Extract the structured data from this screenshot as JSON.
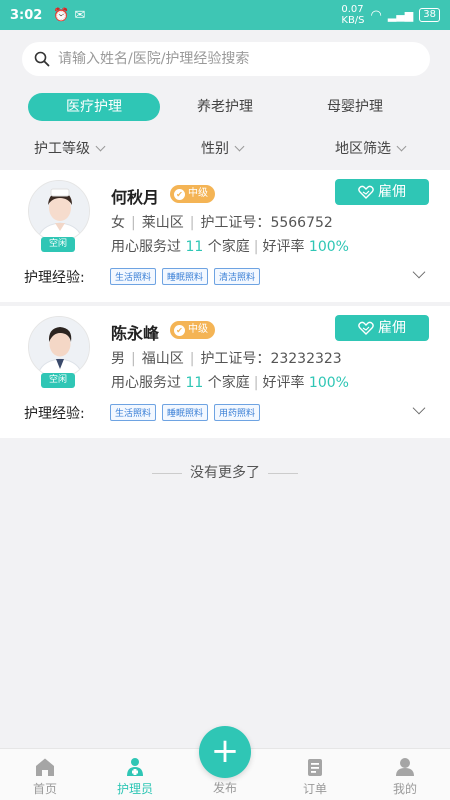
{
  "status_bar": {
    "time": "3:02",
    "network_speed": "0.07",
    "network_unit": "KB/S",
    "battery": "38"
  },
  "search": {
    "placeholder": "请输入姓名/医院/护理经验搜索"
  },
  "tabs": [
    {
      "label": "医疗护理",
      "active": true
    },
    {
      "label": "养老护理",
      "active": false
    },
    {
      "label": "母婴护理",
      "active": false
    }
  ],
  "filters": {
    "level": "护工等级",
    "gender": "性别",
    "region": "地区筛选"
  },
  "caregivers": [
    {
      "name": "何秋月",
      "level": "中级",
      "status": "空闲",
      "gender": "女",
      "district": "莱山区",
      "cert_label": "护工证号：",
      "cert_no": "5566752",
      "served_prefix": "用心服务过",
      "served_count": "11",
      "served_suffix": "个家庭",
      "rating_label": "好评率",
      "rating": "100%",
      "hire_label": "雇佣",
      "exp_label": "护理经验:",
      "exp_tags": [
        "生活照料",
        "睡眠照料",
        "清洁照料"
      ]
    },
    {
      "name": "陈永峰",
      "level": "中级",
      "status": "空闲",
      "gender": "男",
      "district": "福山区",
      "cert_label": "护工证号：",
      "cert_no": "23232323",
      "served_prefix": "用心服务过",
      "served_count": "11",
      "served_suffix": "个家庭",
      "rating_label": "好评率",
      "rating": "100%",
      "hire_label": "雇佣",
      "exp_label": "护理经验:",
      "exp_tags": [
        "生活照料",
        "睡眠照料",
        "用药照料"
      ]
    }
  ],
  "no_more": "没有更多了",
  "bottom_nav": {
    "home": "首页",
    "caregiver": "护理员",
    "publish": "发布",
    "orders": "订单",
    "mine": "我的"
  },
  "colors": {
    "accent": "#2fc6b5",
    "status_bar": "#3ec6b4",
    "level_badge": "#f4b455",
    "tag_blue": "#3a7fd6"
  }
}
